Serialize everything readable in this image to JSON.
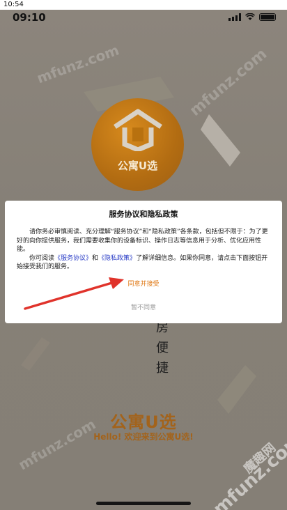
{
  "outer_status": {
    "time": "10:54"
  },
  "status_bar": {
    "time": "09:10"
  },
  "logo": {
    "text": "公寓U选"
  },
  "slogan": [
    "房",
    "便",
    "捷"
  ],
  "brand": {
    "name": "公寓U选",
    "welcome": "Hello! 欢迎来到公寓U选!"
  },
  "watermark": {
    "text": "mfunz.com",
    "cn": "魔趣网"
  },
  "dialog": {
    "title": "服务协议和隐私政策",
    "body_p1": "请你务必审慎阅读、充分理解“服务协议”和“隐私政策”各条款，包括但不限于：为了更好的向你提供服务，我们需要收集你的设备标识、操作日志等信息用于分析、优化应用性能。",
    "body_p2_prefix": "你可阅读",
    "link_service": "《服务协议》",
    "body_p2_and": "和",
    "link_privacy": "《隐私政策》",
    "body_p2_suffix": "了解详细信息。如果你同意，请点击下面按钮开始接受我们的服务。",
    "accept_label": "同意并接受",
    "reject_label": "暂不同意"
  },
  "colors": {
    "accent": "#e07a17",
    "link": "#2c3fc7",
    "brand": "#a3631b",
    "arrow": "#e0332b"
  }
}
